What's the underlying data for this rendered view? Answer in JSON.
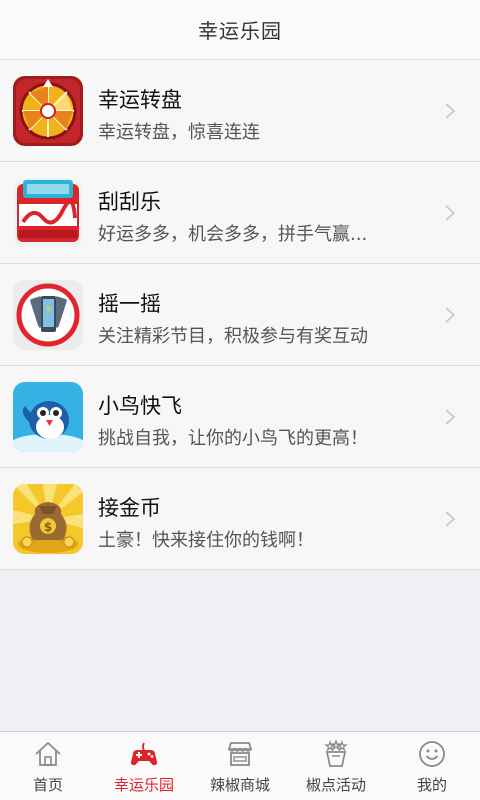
{
  "header": {
    "title": "幸运乐园"
  },
  "games": [
    {
      "name": "幸运转盘",
      "desc": "幸运转盘，惊喜连连",
      "icon": "prize-wheel-icon"
    },
    {
      "name": "刮刮乐",
      "desc": "好运多多，机会多多，拼手气赢...",
      "icon": "scratch-card-icon"
    },
    {
      "name": "摇一摇",
      "desc": "关注精彩节目，积极参与有奖互动",
      "icon": "shake-phone-icon"
    },
    {
      "name": "小鸟快飞",
      "desc": "挑战自我，让你的小鸟飞的更高！",
      "icon": "flying-bird-icon"
    },
    {
      "name": "接金币",
      "desc": "土豪！快来接住你的钱啊！",
      "icon": "money-bag-icon"
    }
  ],
  "tabs": [
    {
      "label": "首页",
      "icon": "home-icon",
      "active": false
    },
    {
      "label": "幸运乐园",
      "icon": "gamepad-icon",
      "active": true
    },
    {
      "label": "辣椒商城",
      "icon": "store-icon",
      "active": false
    },
    {
      "label": "椒点活动",
      "icon": "activity-icon",
      "active": false
    },
    {
      "label": "我的",
      "icon": "smiley-icon",
      "active": false
    }
  ],
  "colors": {
    "accent": "#e02228",
    "background": "#efeff4"
  }
}
